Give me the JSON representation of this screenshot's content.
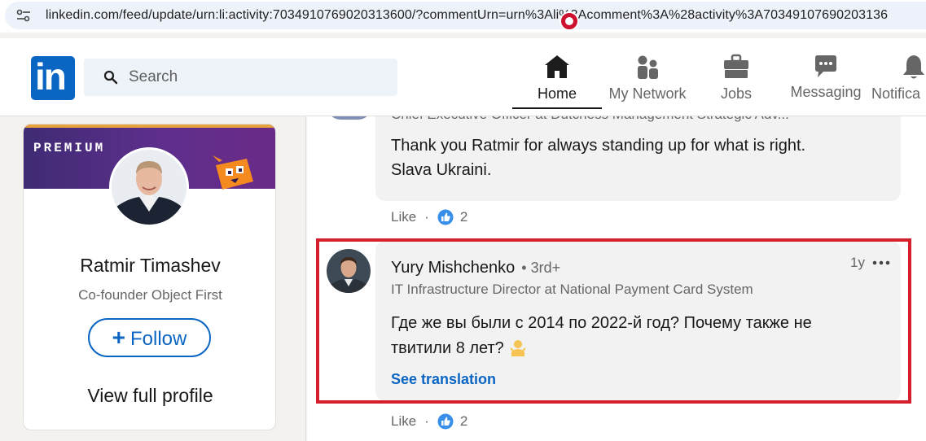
{
  "browser": {
    "url": "linkedin.com/feed/update/urn:li:activity:7034910769020313600/?commentUrn=urn%3Ali%3Acomment%3A%28activity%3A70349107690203136"
  },
  "header": {
    "logo_text": "in",
    "search_placeholder": "Search",
    "nav": [
      {
        "label": "Home",
        "icon": "home-icon",
        "active": true
      },
      {
        "label": "My Network",
        "icon": "network-icon"
      },
      {
        "label": "Jobs",
        "icon": "briefcase-icon"
      },
      {
        "label": "Messaging",
        "icon": "messaging-icon"
      },
      {
        "label": "Notifica",
        "icon": "bell-icon"
      }
    ]
  },
  "profile_card": {
    "banner_label": "PREMIUM",
    "name": "Ratmir Timashev",
    "headline": "Co-founder Object First",
    "follow_label": "Follow",
    "view_profile_label": "View full profile"
  },
  "comments": [
    {
      "headline": "Chief Executive Officer at Dutchess Management Strategic Adv...",
      "text_line1": "Thank you Ratmir for always standing up for what is right.",
      "text_line2": "Slava Ukraini.",
      "like_label": "Like",
      "reaction_count": "2"
    },
    {
      "author": "Yury Mishchenko",
      "degree": "• 3rd+",
      "headline": "IT Infrastructure Director at National Payment Card System",
      "time": "1y",
      "text_line1": "Где же вы были с 2014 по 2022-й год? Почему также не",
      "text_line2": "твитили 8 лет?",
      "see_translation": "See translation",
      "like_label": "Like",
      "reaction_count": "2",
      "highlighted": true
    }
  ],
  "colors": {
    "linkedin_blue": "#0a66c2",
    "highlight_red": "#d61f2c",
    "notification_red": "#cb112d"
  }
}
